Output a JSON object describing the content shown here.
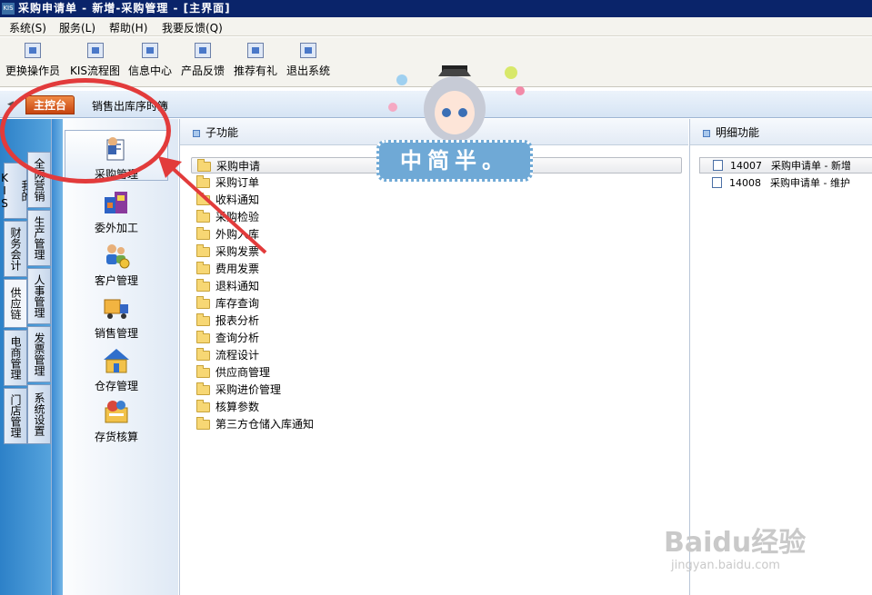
{
  "window": {
    "app_icon_label": "KIS",
    "title": "采购申请单 - 新增-采购管理 - [主界面]"
  },
  "menubar": {
    "items": [
      {
        "label": "系统(S)"
      },
      {
        "label": "服务(L)"
      },
      {
        "label": "帮助(H)"
      },
      {
        "label": "我要反馈(Q)"
      }
    ]
  },
  "toolbar": {
    "items": [
      {
        "label": "更换操作员",
        "icon": "users-icon"
      },
      {
        "label": "KIS流程图",
        "icon": "flowchart-icon"
      },
      {
        "label": "信息中心",
        "icon": "message-icon"
      },
      {
        "label": "产品反馈",
        "icon": "feedback-icon"
      },
      {
        "label": "推荐有礼",
        "icon": "gift-icon"
      },
      {
        "label": "退出系统",
        "icon": "exit-icon"
      }
    ]
  },
  "tabs": {
    "main": "主控台",
    "second": "销售出库序时簿"
  },
  "side_tabs": {
    "left": [
      "我的KIS",
      "财务会计",
      "供应链",
      "电商管理",
      "门店管理"
    ],
    "right": [
      "全网营销",
      "生产管理",
      "人事管理",
      "发票管理",
      "系统设置"
    ]
  },
  "nav": {
    "items": [
      {
        "label": "采购管理",
        "icon": "purchase-icon"
      },
      {
        "label": "委外加工",
        "icon": "outsource-icon"
      },
      {
        "label": "客户管理",
        "icon": "customer-icon"
      },
      {
        "label": "销售管理",
        "icon": "truck-icon"
      },
      {
        "label": "仓存管理",
        "icon": "warehouse-icon"
      },
      {
        "label": "存货核算",
        "icon": "inventory-icon"
      }
    ]
  },
  "subfunctions": {
    "header": "子功能",
    "items": [
      "采购申请",
      "采购订单",
      "收料通知",
      "采购检验",
      "外购入库",
      "采购发票",
      "费用发票",
      "退料通知",
      "库存查询",
      "报表分析",
      "查询分析",
      "流程设计",
      "供应商管理",
      "采购进价管理",
      "核算参数",
      "第三方仓储入库通知"
    ]
  },
  "details": {
    "header": "明细功能",
    "items": [
      {
        "code": "14007",
        "label": "采购申请单 - 新增"
      },
      {
        "code": "14008",
        "label": "采购申请单 - 维护"
      }
    ]
  },
  "overlay": {
    "sticker_text": "中简半。",
    "watermark": "Baidu经验",
    "watermark_sub": "jingyan.baidu.com"
  },
  "colors": {
    "titlebar": "#0a246a",
    "main_tab": "#d85a1c",
    "annotation": "#e23b3b",
    "folder": "#f7d774"
  }
}
